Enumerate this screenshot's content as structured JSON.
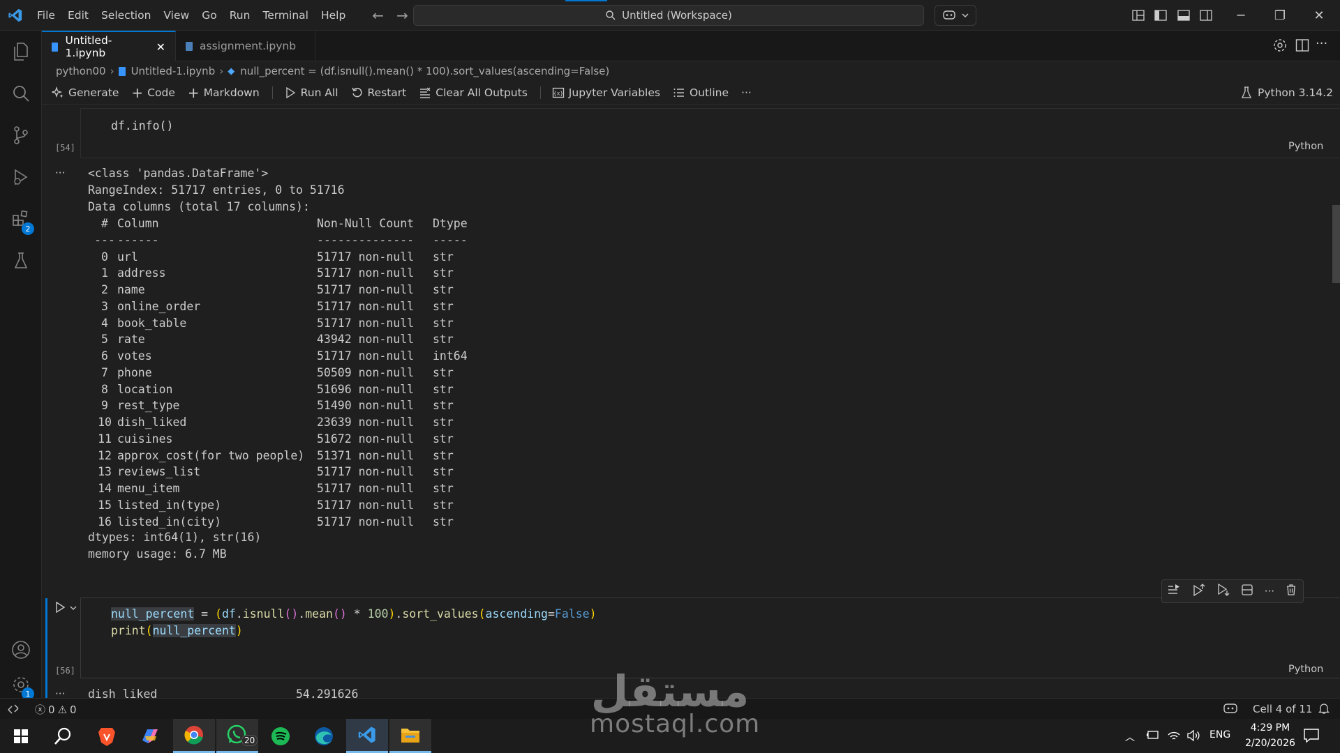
{
  "menu": [
    "File",
    "Edit",
    "Selection",
    "View",
    "Go",
    "Run",
    "Terminal",
    "Help"
  ],
  "command_center": "Untitled (Workspace)",
  "tabs": [
    {
      "label": "Untitled-1.ipynb",
      "active": true
    },
    {
      "label": "assignment.ipynb",
      "active": false
    }
  ],
  "breadcrumb": {
    "folder": "python00",
    "file": "Untitled-1.ipynb",
    "symbol": "null_percent = (df.isnull().mean() * 100).sort_values(ascending=False)"
  },
  "toolbar": {
    "generate": "Generate",
    "code": "Code",
    "markdown": "Markdown",
    "run_all": "Run All",
    "restart": "Restart",
    "clear_outputs": "Clear All Outputs",
    "variables": "Jupyter Variables",
    "outline": "Outline",
    "more": "···",
    "kernel": "Python 3.14.2"
  },
  "activity_badges": {
    "extensions": "2",
    "settings": "1"
  },
  "cell1": {
    "code": "df.info()",
    "exec_count": "[54]",
    "language": "Python"
  },
  "output1": {
    "more": "···",
    "lines": [
      "<class 'pandas.DataFrame'>",
      "RangeIndex: 51717 entries, 0 to 51716",
      "Data columns (total 17 columns):"
    ],
    "header": {
      "idx": "#",
      "column": "Column",
      "count": "Non-Null Count",
      "dtype": "Dtype"
    },
    "separator": {
      "idx": "---",
      "column": "------",
      "count": "--------------",
      "dtype": "-----"
    },
    "rows": [
      {
        "idx": "0",
        "column": "url",
        "count": "51717 non-null",
        "dtype": "str"
      },
      {
        "idx": "1",
        "column": "address",
        "count": "51717 non-null",
        "dtype": "str"
      },
      {
        "idx": "2",
        "column": "name",
        "count": "51717 non-null",
        "dtype": "str"
      },
      {
        "idx": "3",
        "column": "online_order",
        "count": "51717 non-null",
        "dtype": "str"
      },
      {
        "idx": "4",
        "column": "book_table",
        "count": "51717 non-null",
        "dtype": "str"
      },
      {
        "idx": "5",
        "column": "rate",
        "count": "43942 non-null",
        "dtype": "str"
      },
      {
        "idx": "6",
        "column": "votes",
        "count": "51717 non-null",
        "dtype": "int64"
      },
      {
        "idx": "7",
        "column": "phone",
        "count": "50509 non-null",
        "dtype": "str"
      },
      {
        "idx": "8",
        "column": "location",
        "count": "51696 non-null",
        "dtype": "str"
      },
      {
        "idx": "9",
        "column": "rest_type",
        "count": "51490 non-null",
        "dtype": "str"
      },
      {
        "idx": "10",
        "column": "dish_liked",
        "count": "23639 non-null",
        "dtype": "str"
      },
      {
        "idx": "11",
        "column": "cuisines",
        "count": "51672 non-null",
        "dtype": "str"
      },
      {
        "idx": "12",
        "column": "approx_cost(for two people)",
        "count": "51371 non-null",
        "dtype": "str"
      },
      {
        "idx": "13",
        "column": "reviews_list",
        "count": "51717 non-null",
        "dtype": "str"
      },
      {
        "idx": "14",
        "column": "menu_item",
        "count": "51717 non-null",
        "dtype": "str"
      },
      {
        "idx": "15",
        "column": "listed_in(type)",
        "count": "51717 non-null",
        "dtype": "str"
      },
      {
        "idx": "16",
        "column": "listed_in(city)",
        "count": "51717 non-null",
        "dtype": "str"
      }
    ],
    "footer": [
      "dtypes: int64(1), str(16)",
      "memory usage: 6.7 MB"
    ]
  },
  "cell2": {
    "line1": {
      "var": "null_percent",
      "eq": " = ",
      "p1": "(",
      "obj": "df",
      "dot1": ".",
      "fn1": "isnull",
      "p2": "()",
      "dot2": ".",
      "fn2": "mean",
      "p3": "()",
      "mul": " * ",
      "num": "100",
      "p4": ")",
      "dot3": ".",
      "fn3": "sort_values",
      "p5": "(",
      "param": "ascending",
      "eq2": "=",
      "kw": "False",
      "p6": ")"
    },
    "line2": {
      "fn": "print",
      "p1": "(",
      "arg": "null_percent",
      "p2": ")"
    },
    "exec_count": "[56]",
    "language": "Python"
  },
  "output2": {
    "more": "···",
    "partial_line": {
      "name": "dish_liked",
      "value": "54.291626"
    }
  },
  "status": {
    "errors": "0",
    "warnings": "0",
    "cell_position": "Cell 4 of 11"
  },
  "taskbar": {
    "whatsapp_badge": "20",
    "language": "ENG",
    "time": "4:29 PM",
    "date": "2/20/2026"
  },
  "watermark": {
    "arabic": "مستقل",
    "latin": "mostaql.com"
  },
  "colors": {
    "accent": "#0078d4",
    "background": "#1f1f1f",
    "keyword": "#569cd6",
    "function": "#dcdcaa"
  }
}
